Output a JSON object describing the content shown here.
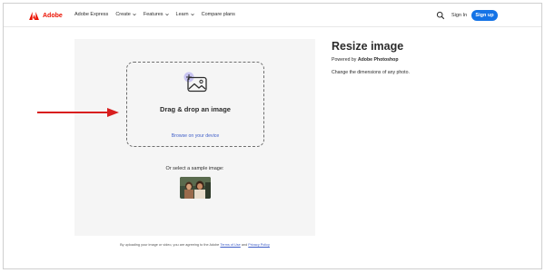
{
  "header": {
    "brand": "Adobe",
    "nav": [
      {
        "label": "Adobe Express",
        "has_dropdown": false
      },
      {
        "label": "Create",
        "has_dropdown": true
      },
      {
        "label": "Features",
        "has_dropdown": true
      },
      {
        "label": "Learn",
        "has_dropdown": true
      },
      {
        "label": "Compare plans",
        "has_dropdown": false
      }
    ],
    "sign_in": "Sign In",
    "sign_up": "Sign up"
  },
  "upload": {
    "drop_title": "Drag & drop an image",
    "browse_link": "Browse on your device",
    "sample_label": "Or select a sample image:",
    "terms_prefix": "By uploading your image or video, you are agreeing to the Adobe",
    "terms_link": "Terms of Use",
    "terms_and": "and",
    "privacy_link": "Privacy Policy"
  },
  "info": {
    "title": "Resize image",
    "powered_prefix": "Powered by",
    "powered_product": "Adobe Photoshop",
    "description": "Change the dimensions of any photo."
  },
  "colors": {
    "brand_red": "#eb1000",
    "primary_blue": "#1473e6",
    "link_blue": "#3f5ec8",
    "annotation_red": "#d81e1e",
    "panel_bg": "#f5f5f5"
  },
  "icons": [
    "adobe-logo-icon",
    "chevron-down-icon",
    "search-icon",
    "add-image-icon",
    "sample-photo-thumbnail",
    "annotation-arrow"
  ]
}
